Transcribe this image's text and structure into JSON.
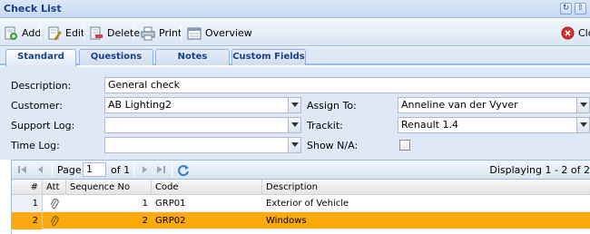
{
  "window": {
    "title": "Check List"
  },
  "toolbar": {
    "add": "Add",
    "edit": "Edit",
    "delete": "Delete",
    "print": "Print",
    "overview": "Overview",
    "close": "Close"
  },
  "tabs": [
    {
      "label": "Standard",
      "active": true
    },
    {
      "label": "Questions",
      "active": false
    },
    {
      "label": "Notes",
      "active": false
    },
    {
      "label": "Custom Fields",
      "active": false
    }
  ],
  "form": {
    "description_label": "Description:",
    "description_value": "General check",
    "customer_label": "Customer:",
    "customer_value": "AB Lighting2",
    "assign_label": "Assign To:",
    "assign_value": "Anneline van der Vyver",
    "support_label": "Support Log:",
    "support_value": "",
    "trackit_label": "Trackit:",
    "trackit_value": "Renault 1.4",
    "time_label": "Time Log:",
    "time_value": "",
    "shown_label": "Show N/A:",
    "shown_checked": false
  },
  "pager": {
    "page_label": "Page",
    "page_value": "1",
    "of_label": "of 1",
    "display_text": "Displaying 1 - 2 of 2"
  },
  "grid": {
    "columns": [
      "#",
      "Att",
      "Sequence No",
      "Code",
      "Description"
    ],
    "rows": [
      {
        "num": "1",
        "seq": "1",
        "code": "GRP01",
        "desc": "Exterior of Vehicle",
        "selected": false
      },
      {
        "num": "2",
        "seq": "2",
        "code": "GRP02",
        "desc": "Windows",
        "selected": true
      }
    ]
  },
  "colors": {
    "header_blue": "#15428b",
    "selected_row": "#fba90b",
    "panel_bg": "#dfe8f6"
  }
}
